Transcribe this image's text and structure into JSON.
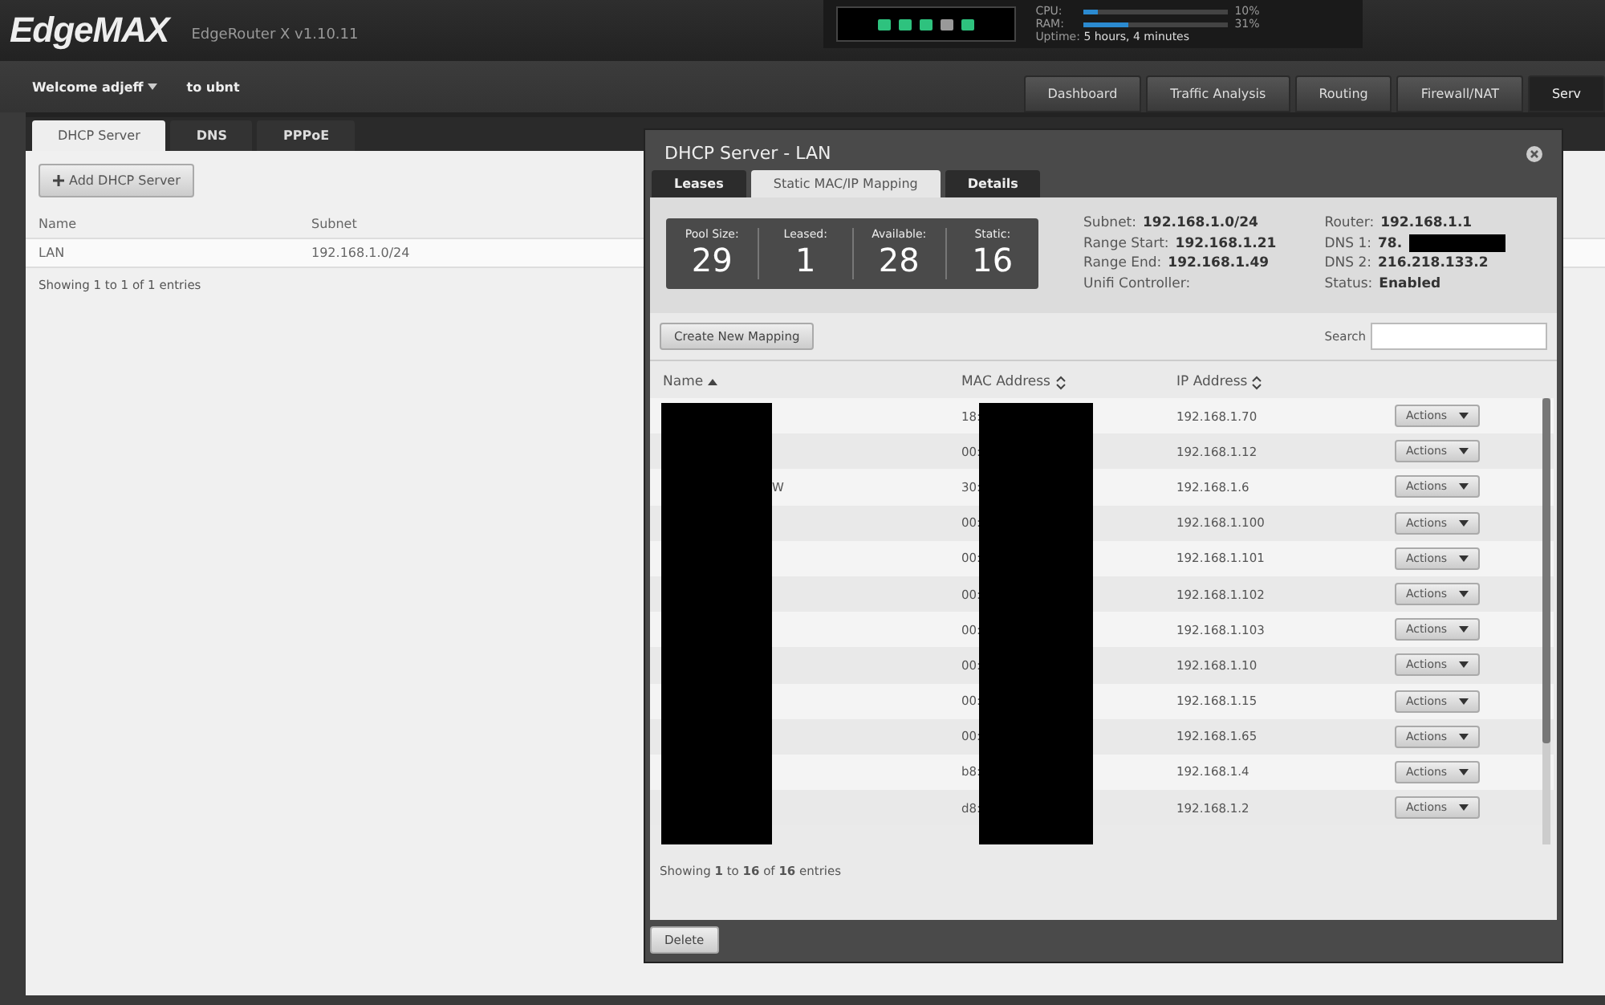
{
  "header": {
    "logo": "EdgeMAX",
    "product": "EdgeRouter X v1.10.11",
    "ports": [
      {
        "on": true
      },
      {
        "on": true
      },
      {
        "on": true
      },
      {
        "on": false
      },
      {
        "on": true
      }
    ],
    "stats": [
      {
        "label": "CPU:",
        "level": 0.1,
        "reading": "10%"
      },
      {
        "label": "RAM:",
        "level": 0.31,
        "reading": "31%"
      }
    ],
    "uptime": {
      "label": "Uptime:",
      "value": "5 hours, 4 minutes"
    }
  },
  "user_bar": {
    "welcome": "Welcome adjeff",
    "to": "to ubnt"
  },
  "nav_tabs": [
    {
      "label": "Dashboard",
      "selected": false
    },
    {
      "label": "Traffic Analysis",
      "selected": false
    },
    {
      "label": "Routing",
      "selected": false
    },
    {
      "label": "Firewall/NAT",
      "selected": false
    },
    {
      "label": "Serv",
      "selected": true
    }
  ],
  "service_tabs": [
    {
      "label": "DHCP Server",
      "selected": true
    },
    {
      "label": "DNS",
      "selected": false
    },
    {
      "label": "PPPoE",
      "selected": false
    }
  ],
  "add_button": "Add DHCP Server",
  "servers_table": {
    "columns": [
      "Name",
      "Subnet"
    ],
    "rows": [
      [
        "LAN",
        "192.168.1.0/24"
      ]
    ],
    "footer": "Showing 1 to 1 of 1 entries"
  },
  "dialog": {
    "title": "DHCP Server - LAN",
    "tabs": [
      {
        "label": "Leases",
        "selected": false
      },
      {
        "label": "Static MAC/IP Mapping",
        "selected": true
      },
      {
        "label": "Details",
        "selected": false
      }
    ],
    "pool": [
      {
        "label": "Pool Size:",
        "value": "29"
      },
      {
        "label": "Leased:",
        "value": "1"
      },
      {
        "label": "Available:",
        "value": "28"
      },
      {
        "label": "Static:",
        "value": "16"
      }
    ],
    "info_left": [
      {
        "label": "Subnet:",
        "value": "192.168.1.0/24"
      },
      {
        "label": "Range Start:",
        "value": "192.168.1.21"
      },
      {
        "label": "Range End:",
        "value": "192.168.1.49"
      },
      {
        "label": "Unifi Controller:"
      }
    ],
    "info_right": [
      {
        "label": "Router:",
        "value": "192.168.1.1"
      },
      {
        "label": "DNS 1:",
        "value": "78.",
        "redacted": true
      },
      {
        "label": "DNS 2:",
        "value": "216.218.133.2"
      },
      {
        "label": "Status:",
        "value": "Enabled"
      }
    ],
    "create_button": "Create New Mapping",
    "search_label": "Search",
    "columns": [
      "Name",
      "MAC Address",
      "IP Address"
    ],
    "rows": [
      {
        "mac": "18:",
        "ip": "192.168.1.70",
        "action": "Actions"
      },
      {
        "mac": "00:",
        "ip": "192.168.1.12",
        "action": "Actions"
      },
      {
        "name": "W",
        "mac": "30:",
        "ip": "192.168.1.6",
        "action": "Actions"
      },
      {
        "mac": "00:",
        "ip": "192.168.1.100",
        "action": "Actions"
      },
      {
        "mac": "00:",
        "ip": "192.168.1.101",
        "action": "Actions"
      },
      {
        "mac": "00:",
        "ip": "192.168.1.102",
        "action": "Actions"
      },
      {
        "mac": "00:",
        "ip": "192.168.1.103",
        "action": "Actions"
      },
      {
        "mac": "00:",
        "ip": "192.168.1.10",
        "action": "Actions"
      },
      {
        "mac": "00:",
        "ip": "192.168.1.15",
        "action": "Actions"
      },
      {
        "mac": "00:",
        "ip": "192.168.1.65",
        "action": "Actions"
      },
      {
        "mac": "b8:",
        "ip": "192.168.1.4",
        "action": "Actions"
      },
      {
        "mac": "d8:",
        "ip": "192.168.1.2",
        "action": "Actions"
      }
    ],
    "footer": "Showing **1** to **16** of **16** entries",
    "delete_button": "Delete"
  }
}
